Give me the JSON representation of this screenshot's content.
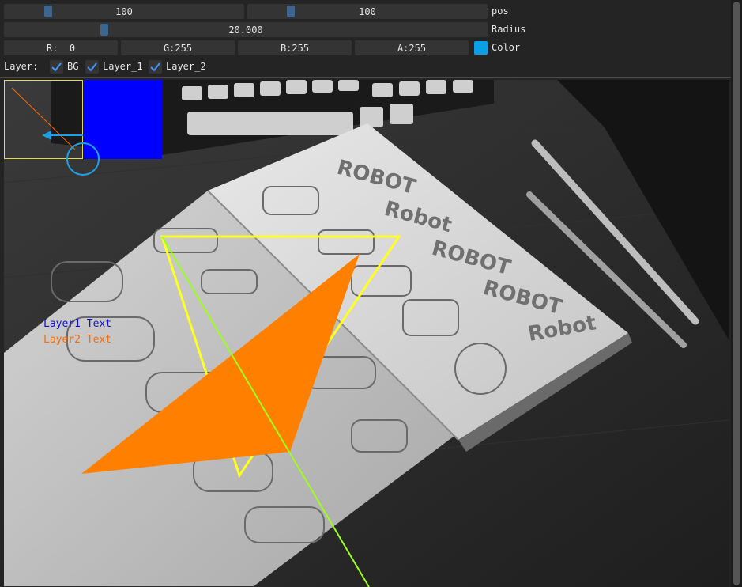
{
  "controls": {
    "pos": {
      "x_value": "100",
      "y_value": "100",
      "label": "pos"
    },
    "radius": {
      "value": "20.000",
      "label": "Radius"
    },
    "color": {
      "r": "R:  0",
      "g": "G:255",
      "b": "B:255",
      "a": "A:255",
      "label": "Color",
      "swatch": "#0aa0e8"
    }
  },
  "layers": {
    "label": "Layer:",
    "items": [
      {
        "label": "BG",
        "checked": true
      },
      {
        "label": "Layer_1",
        "checked": true
      },
      {
        "label": "Layer_2",
        "checked": true
      }
    ]
  },
  "canvas": {
    "layer1_text": "Layer1 Text",
    "layer2_text": "Layer2 Text",
    "layer1_text_color": "#1414c8",
    "layer2_text_color": "#ff6a00",
    "blue_rect_color": "#0000ff",
    "orange_triangle_color": "#ff8000",
    "yellow_triangle_color": "#ffff22",
    "green_line_color": "#9bff1a",
    "circle_color": "#1ea0e6"
  }
}
